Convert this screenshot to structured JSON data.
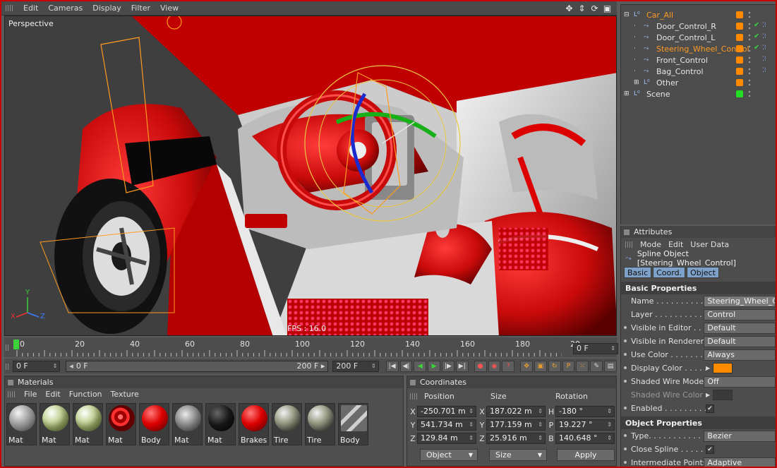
{
  "colors": {
    "accent": "#ff8a00",
    "selected": "#ff9a20",
    "border": "#c40000",
    "car_red": "#c80a0a"
  },
  "viewport_menu": {
    "items": [
      "Edit",
      "Cameras",
      "Display",
      "Filter",
      "View"
    ]
  },
  "viewport": {
    "label": "Perspective",
    "fps": "FPS : 16.0",
    "axis_labels": {
      "y": "Y",
      "x": "X",
      "z": "Z"
    }
  },
  "timeline": {
    "ticks": [
      "0",
      "20",
      "40",
      "60",
      "80",
      "100",
      "120",
      "140",
      "160",
      "180",
      "20"
    ],
    "current_frame": "0 F",
    "start_field": "0 F",
    "range_start": "0 F",
    "range_end": "200 F",
    "end_field": "200 F"
  },
  "materials": {
    "title": "Materials",
    "menu": [
      "File",
      "Edit",
      "Function",
      "Texture"
    ],
    "items": [
      {
        "name": "Mat",
        "style": "grey"
      },
      {
        "name": "Mat",
        "style": "map"
      },
      {
        "name": "Mat",
        "style": "map"
      },
      {
        "name": "Mat",
        "style": "swirl"
      },
      {
        "name": "Body",
        "style": "red"
      },
      {
        "name": "Mat",
        "style": "plate"
      },
      {
        "name": "Mat",
        "style": "black"
      },
      {
        "name": "Brakes",
        "style": "red"
      },
      {
        "name": "Tire",
        "style": "env"
      },
      {
        "name": "Tire",
        "style": "env"
      },
      {
        "name": "Body",
        "style": "stripe"
      }
    ]
  },
  "coordinates": {
    "title": "Coordinates",
    "headers": [
      "Position",
      "Size",
      "Rotation"
    ],
    "rows": [
      {
        "pos_label": "X",
        "pos": "-250.701 m",
        "size_label": "X",
        "size": "187.022 m",
        "rot_label": "H",
        "rot": "-180 °"
      },
      {
        "pos_label": "Y",
        "pos": "541.734 m",
        "size_label": "Y",
        "size": "177.159 m",
        "rot_label": "P",
        "rot": "19.227 °"
      },
      {
        "pos_label": "Z",
        "pos": "129.84 m",
        "size_label": "Z",
        "size": "25.916 m",
        "rot_label": "B",
        "rot": "140.648 °"
      }
    ],
    "mode_select": "Object",
    "size_select": "Size",
    "apply_label": "Apply"
  },
  "objects": [
    {
      "name": "Car_All",
      "indent": 0,
      "selected": true,
      "tag": "#ff8a00",
      "check": false,
      "tagicon": false,
      "toggle": "⊟"
    },
    {
      "name": "Door_Control_R",
      "indent": 1,
      "selected": false,
      "tag": "#ff8a00",
      "check": true,
      "tagicon": true,
      "toggle": ""
    },
    {
      "name": "Door_Control_L",
      "indent": 1,
      "selected": false,
      "tag": "#ff8a00",
      "check": true,
      "tagicon": true,
      "toggle": ""
    },
    {
      "name": "Steering_Wheel_Control",
      "indent": 1,
      "selected": true,
      "tag": "#ff8a00",
      "check": true,
      "tagicon": true,
      "toggle": ""
    },
    {
      "name": "Front_Control",
      "indent": 1,
      "selected": false,
      "tag": "#ff8a00",
      "check": false,
      "tagicon": true,
      "toggle": ""
    },
    {
      "name": "Bag_Control",
      "indent": 1,
      "selected": false,
      "tag": "#ff8a00",
      "check": false,
      "tagicon": true,
      "toggle": ""
    },
    {
      "name": "Other",
      "indent": 1,
      "selected": false,
      "tag": "#ff8a00",
      "check": false,
      "tagicon": false,
      "toggle": "⊞"
    },
    {
      "name": "Scene",
      "indent": 0,
      "selected": false,
      "tag": "#22dd22",
      "check": false,
      "tagicon": false,
      "toggle": "⊞"
    }
  ],
  "attributes": {
    "title": "Attributes",
    "menu": [
      "Mode",
      "Edit",
      "User Data"
    ],
    "object_title": "Spline Object [Steering_Wheel_Control]",
    "tabs": [
      "Basic",
      "Coord.",
      "Object"
    ],
    "basic_header": "Basic Properties",
    "basic": [
      {
        "label": "Name . . . . . . . . . . . .",
        "value": "Steering_Wheel_Control",
        "kind": "input",
        "bullet": false,
        "dim": false
      },
      {
        "label": "Layer . . . . . . . . . . . .",
        "value": "Control",
        "kind": "field",
        "bullet": false,
        "dim": false
      },
      {
        "label": "Visible in Editor . . . . .",
        "value": "Default",
        "kind": "field",
        "bullet": true,
        "dim": false
      },
      {
        "label": "Visible in Renderer . .",
        "value": "Default",
        "kind": "field",
        "bullet": true,
        "dim": false
      },
      {
        "label": "Use Color . . . . . . . . .",
        "value": "Always",
        "kind": "field",
        "bullet": true,
        "dim": false
      },
      {
        "label": "Display Color . . . . .",
        "value": "#ff8a00",
        "kind": "swatch",
        "bullet": true,
        "dim": false
      },
      {
        "label": "Shaded Wire Mode",
        "value": "Off",
        "kind": "field",
        "bullet": true,
        "dim": false
      },
      {
        "label": "Shaded Wire Color",
        "value": "#3a3a3a",
        "kind": "swatch",
        "bullet": false,
        "dim": true
      },
      {
        "label": "Enabled . . . . . . . . . .",
        "value": "✔",
        "kind": "check",
        "bullet": true,
        "dim": false
      }
    ],
    "object_header": "Object Properties",
    "object": [
      {
        "label": "Type. . . . . . . . . . . .",
        "value": "Bezier",
        "kind": "field",
        "bullet": true,
        "dim": false
      },
      {
        "label": "Close Spline . . . . .",
        "value": "✔",
        "kind": "check",
        "bullet": true,
        "dim": false
      },
      {
        "label": "Intermediate Points",
        "value": "Adaptive",
        "kind": "field",
        "bullet": true,
        "dim": false
      }
    ]
  }
}
